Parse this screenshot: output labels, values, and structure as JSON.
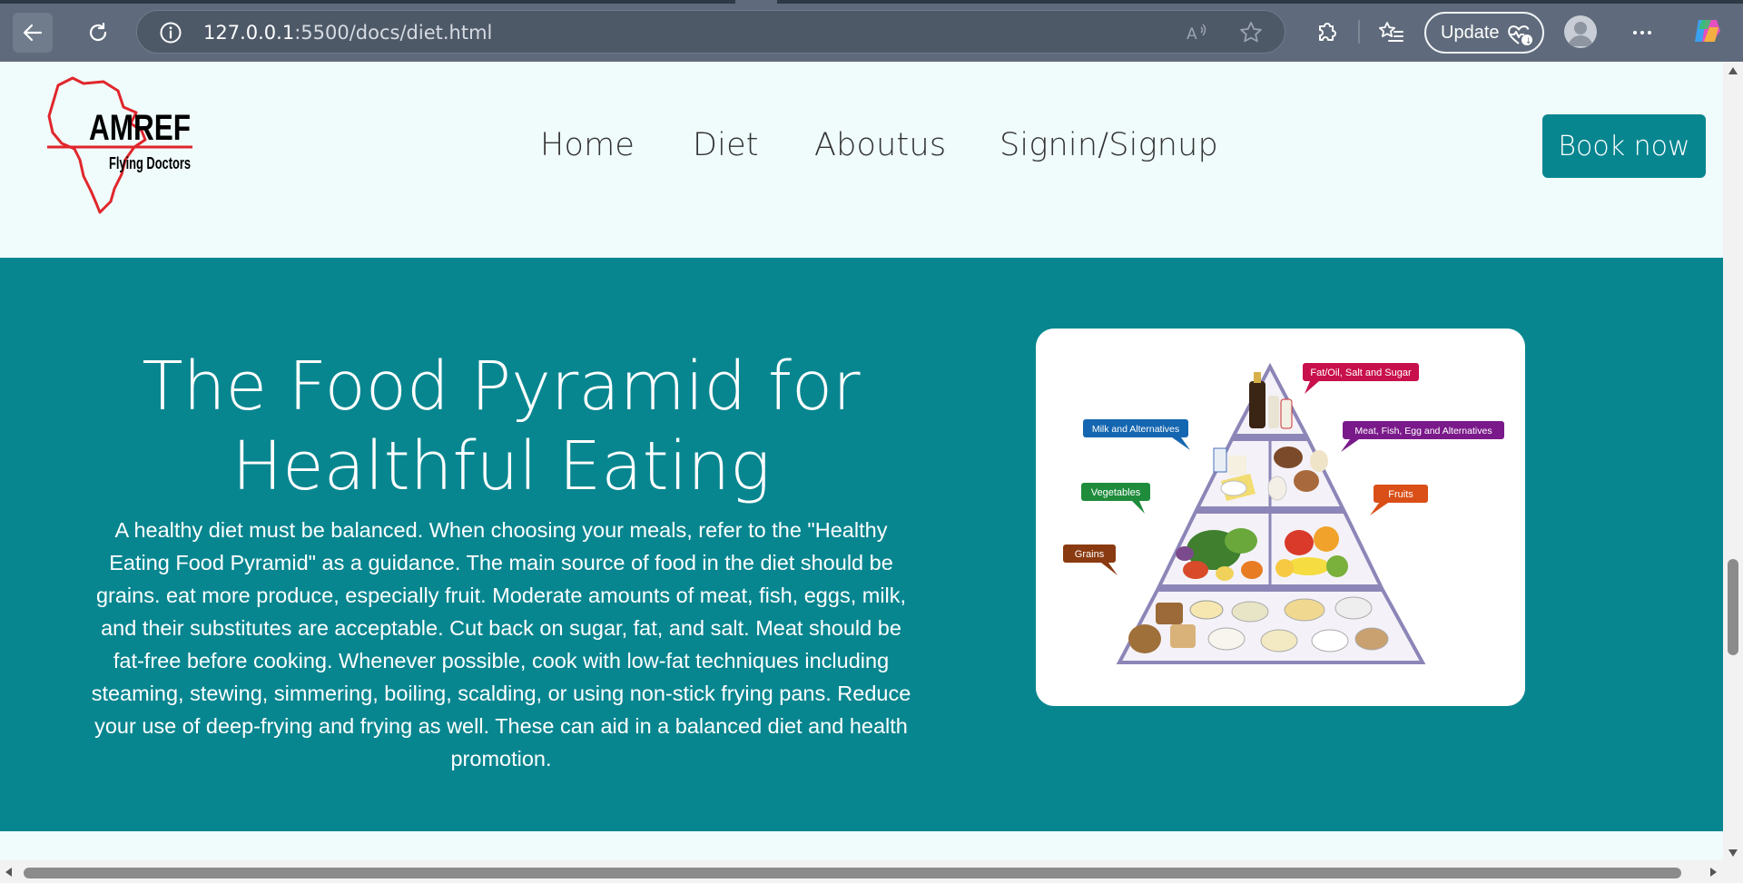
{
  "browser": {
    "url_host": "127.0.0.1",
    "url_path": ":5500/docs/diet.html",
    "update_label": "Update"
  },
  "nav": {
    "brand_name": "AMREF",
    "brand_sub": "Flying Doctors",
    "links": [
      "Home",
      "Diet",
      "Aboutus",
      "Signin/Signup"
    ],
    "book_label": "Book now"
  },
  "hero": {
    "title_line1": "The Food Pyramid for",
    "title_line2": "Healthful Eating",
    "body": "A healthy diet must be balanced. When choosing your meals, refer to the \"Healthy Eating Food Pyramid\" as a guidance. The main source of food in the diet should be grains. eat more produce, especially fruit. Moderate amounts of meat, fish, eggs, milk, and their substitutes are acceptable. Cut back on sugar, fat, and salt. Meat should be fat-free before cooking. Whenever possible, cook with low-fat techniques including steaming, stewing, simmering, boiling, scalding, or using non-stick frying pans. Reduce your use of deep-frying and frying as well. These can aid in a balanced diet and health promotion."
  },
  "pyramid": {
    "labels": {
      "fat": "Fat/Oil, Salt and Sugar",
      "milk": "Milk and Alternatives",
      "meat": "Meat, Fish, Egg and Alternatives",
      "veg": "Vegetables",
      "fruits": "Fruits",
      "grains": "Grains"
    }
  },
  "colors": {
    "teal": "#088690",
    "page_bg": "#f0fbfb",
    "chrome": "#5f6b7c"
  }
}
